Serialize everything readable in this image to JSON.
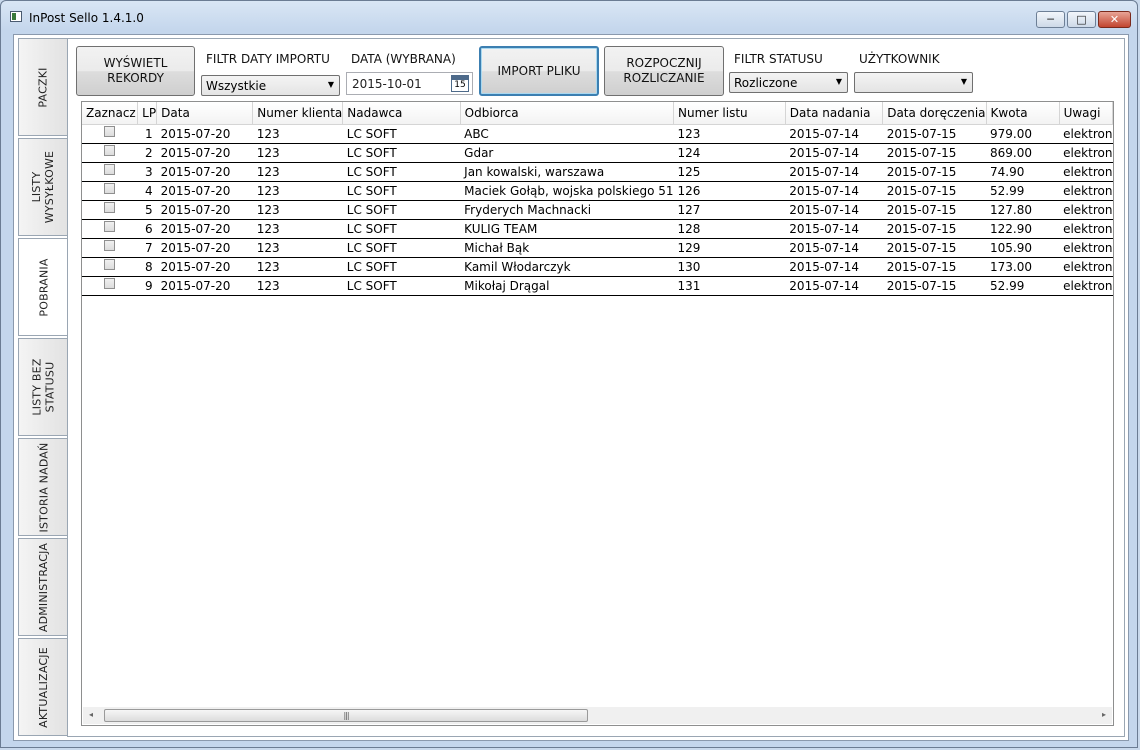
{
  "window": {
    "title": "InPost Sello 1.4.1.0",
    "minimize_glyph": "─",
    "maximize_glyph": "□",
    "close_glyph": "✕"
  },
  "sidebar": {
    "tabs": [
      {
        "label": "PACZKI"
      },
      {
        "label": "LISTY\nWYSYŁKOWE"
      },
      {
        "label": "POBRANIA"
      },
      {
        "label": "LISTY BEZ\nSTATUSU"
      },
      {
        "label": "ISTORIA NADAŃ"
      },
      {
        "label": "ADMINISTRACJA"
      },
      {
        "label": "AKTUALIZACJE"
      }
    ]
  },
  "toolbar": {
    "show_records_label": "WYŚWIETL REKORDY",
    "import_date_filter_label": "FILTR DATY IMPORTU",
    "import_date_filter_value": "Wszystkie",
    "date_selected_label": "DATA (WYBRANA)",
    "date_selected_value": "2015-10-01",
    "calendar_day": "15",
    "import_file_label": "IMPORT PLIKU",
    "start_settlement_label": "ROZPOCZNIJ\nROZLICZANIE",
    "status_filter_label": "FILTR STATUSU",
    "status_filter_value": "Rozliczone",
    "user_label": "UŻYTKOWNIK",
    "user_value": ""
  },
  "grid": {
    "columns": [
      "Zaznacz",
      "LP",
      "Data",
      "Numer klienta",
      "Nadawca",
      "Odbiorca",
      "Numer listu",
      "Data nadania",
      "Data doręczenia",
      "Kwota",
      "Uwagi"
    ],
    "rows": [
      {
        "lp": "1",
        "data": "2015-07-20",
        "klient": "123",
        "nadawca": "LC SOFT",
        "odbiorca": "ABC",
        "numer": "123",
        "nadania": "2015-07-14",
        "doreczenia": "2015-07-15",
        "kwota": "979.00",
        "uwagi": "elektron"
      },
      {
        "lp": "2",
        "data": "2015-07-20",
        "klient": "123",
        "nadawca": "LC SOFT",
        "odbiorca": "Gdar",
        "numer": "124",
        "nadania": "2015-07-14",
        "doreczenia": "2015-07-15",
        "kwota": "869.00",
        "uwagi": "elektron"
      },
      {
        "lp": "3",
        "data": "2015-07-20",
        "klient": "123",
        "nadawca": "LC SOFT",
        "odbiorca": "Jan kowalski, warszawa",
        "numer": "125",
        "nadania": "2015-07-14",
        "doreczenia": "2015-07-15",
        "kwota": "74.90",
        "uwagi": "elektron"
      },
      {
        "lp": "4",
        "data": "2015-07-20",
        "klient": "123",
        "nadawca": "LC SOFT",
        "odbiorca": "Maciek Gołąb, wojska polskiego 51",
        "numer": "126",
        "nadania": "2015-07-14",
        "doreczenia": "2015-07-15",
        "kwota": "52.99",
        "uwagi": "elektron"
      },
      {
        "lp": "5",
        "data": "2015-07-20",
        "klient": "123",
        "nadawca": "LC SOFT",
        "odbiorca": "Fryderych Machnacki",
        "numer": "127",
        "nadania": "2015-07-14",
        "doreczenia": "2015-07-15",
        "kwota": "127.80",
        "uwagi": "elektron"
      },
      {
        "lp": "6",
        "data": "2015-07-20",
        "klient": "123",
        "nadawca": "LC SOFT",
        "odbiorca": "KULIG TEAM",
        "numer": "128",
        "nadania": "2015-07-14",
        "doreczenia": "2015-07-15",
        "kwota": "122.90",
        "uwagi": "elektron"
      },
      {
        "lp": "7",
        "data": "2015-07-20",
        "klient": "123",
        "nadawca": "LC SOFT",
        "odbiorca": "Michał Bąk",
        "numer": "129",
        "nadania": "2015-07-14",
        "doreczenia": "2015-07-15",
        "kwota": "105.90",
        "uwagi": "elektron"
      },
      {
        "lp": "8",
        "data": "2015-07-20",
        "klient": "123",
        "nadawca": "LC SOFT",
        "odbiorca": "Kamil Włodarczyk",
        "numer": "130",
        "nadania": "2015-07-14",
        "doreczenia": "2015-07-15",
        "kwota": "173.00",
        "uwagi": "elektron"
      },
      {
        "lp": "9",
        "data": "2015-07-20",
        "klient": "123",
        "nadawca": "LC SOFT",
        "odbiorca": "Mikołaj Drągal",
        "numer": "131",
        "nadania": "2015-07-14",
        "doreczenia": "2015-07-15",
        "kwota": "52.99",
        "uwagi": "elektron"
      }
    ],
    "scroll_left_glyph": "◂",
    "scroll_right_glyph": "▸",
    "scroll_thumb_grip": "|||"
  },
  "icons": {
    "dropdown": "▼"
  }
}
